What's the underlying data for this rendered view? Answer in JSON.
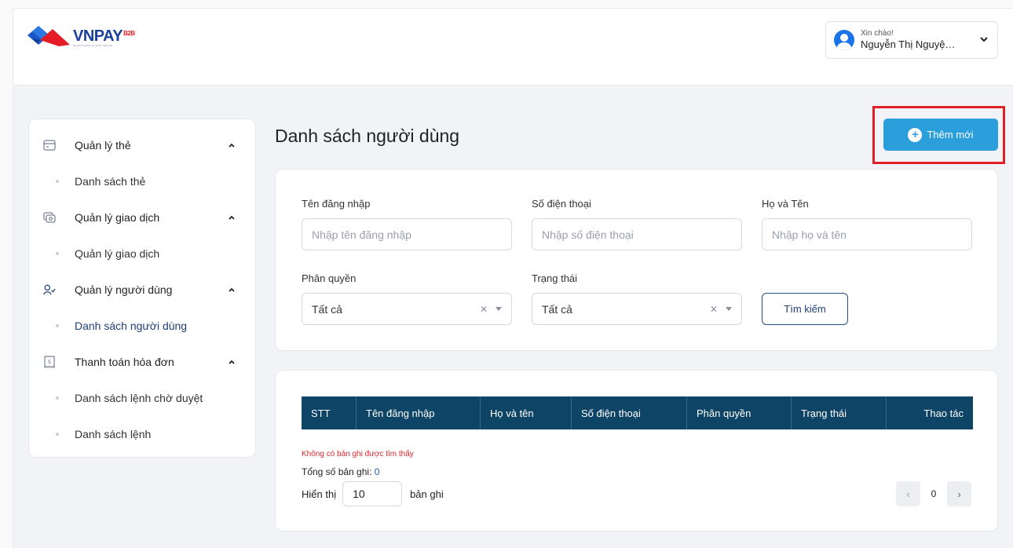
{
  "header": {
    "logo_text": "VNPAY",
    "logo_sup": "B2B",
    "logo_tagline": "NHANH CHÓNG AN TOÀN TIỆN LỢI",
    "greeting": "Xin chào!",
    "user_name": "Nguyễn Thị Nguyệt",
    "user_name_display": "Nguyễn Thị Nguyệ…"
  },
  "sidebar": {
    "groups": [
      {
        "label": "Quản lý thẻ",
        "icon": "card-icon",
        "items": [
          "Danh sách thẻ"
        ]
      },
      {
        "label": "Quản lý giao dịch",
        "icon": "transaction-icon",
        "items": [
          "Quản lý giao dịch"
        ]
      },
      {
        "label": "Quản lý người dùng",
        "icon": "user-manage-icon",
        "items": [
          "Danh sách người dùng"
        ]
      },
      {
        "label": "Thanh toán hóa đơn",
        "icon": "bill-icon",
        "items": [
          "Danh sách lệnh chờ duyệt",
          "Danh sách lệnh"
        ]
      }
    ],
    "active_item": "Danh sách người dùng"
  },
  "page": {
    "title": "Danh sách người dùng",
    "add_button": "Thêm mới"
  },
  "filters": {
    "username_label": "Tên đăng nhập",
    "username_placeholder": "Nhập tên đăng nhập",
    "phone_label": "Số điện thoại",
    "phone_placeholder": "Nhập số điện thoại",
    "fullname_label": "Họ và Tên",
    "fullname_placeholder": "Nhập họ và tên",
    "role_label": "Phân quyền",
    "role_value": "Tất cả",
    "status_label": "Trạng thái",
    "status_value": "Tất cả",
    "search_button": "Tìm kiếm"
  },
  "table": {
    "columns": [
      "STT",
      "Tên đăng nhập",
      "Họ và tên",
      "Số điện thoại",
      "Phân quyền",
      "Trạng thái",
      "Thao tác"
    ],
    "empty_message": "Không có bản ghi được tìm thấy",
    "total_label": "Tổng số bản ghi:",
    "total_value": "0",
    "show_label": "Hiển thị",
    "page_size": "10",
    "records_label": "bản ghi",
    "current_page": "0"
  },
  "colors": {
    "accent": "#2b9fdb",
    "table_header": "#0e4466",
    "highlight": "#e01f26",
    "brand_blue": "#1a3f9c",
    "brand_red": "#e31c25"
  }
}
